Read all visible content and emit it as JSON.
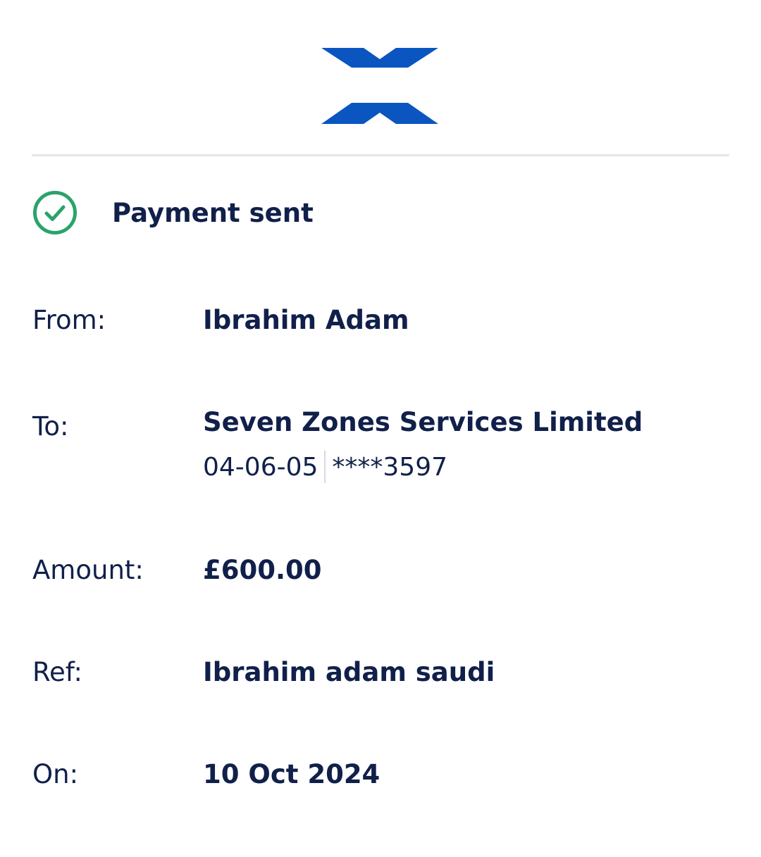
{
  "brand": {
    "logo_text": "HALIFAX",
    "color": "#0a55c0"
  },
  "status": {
    "icon": "check-circle-icon",
    "text": "Payment sent",
    "color": "#2aa36b"
  },
  "details": {
    "from": {
      "label": "From:",
      "value": "Ibrahim Adam"
    },
    "to": {
      "label": "To:",
      "value": "Seven Zones Services Limited",
      "sort_code": "04-06-05",
      "account_number": "****3597"
    },
    "amount": {
      "label": "Amount:",
      "value": "£600.00"
    },
    "ref": {
      "label": "Ref:",
      "value": "Ibrahim adam saudi"
    },
    "on": {
      "label": "On:",
      "value": "10 Oct 2024"
    }
  }
}
